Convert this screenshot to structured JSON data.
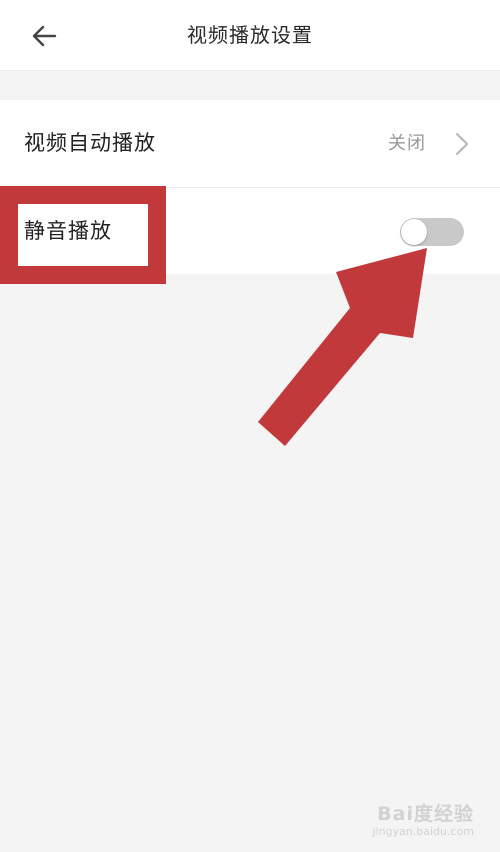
{
  "header": {
    "title": "视频播放设置",
    "back_icon": "arrow-left-icon"
  },
  "settings": {
    "autoplay": {
      "label": "视频自动播放",
      "value": "关闭",
      "icon": "chevron-right-icon"
    },
    "mute_play": {
      "label": "静音播放",
      "toggle_on": false
    }
  },
  "annotation": {
    "color": "#c2393c"
  },
  "watermark": {
    "brand": "Bai度经验",
    "url": "jingyan.baidu.com"
  },
  "colors": {
    "background": "#f4f4f4",
    "surface": "#ffffff",
    "toggle_off": "#c9c9c9",
    "secondary_text": "#999999"
  }
}
